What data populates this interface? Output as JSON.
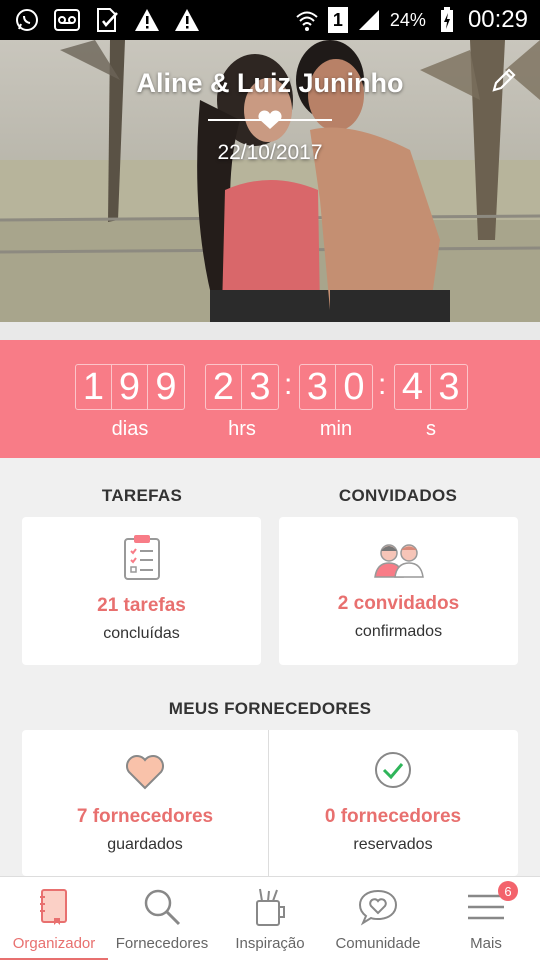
{
  "status_bar": {
    "battery_percent": "24%",
    "time": "00:29",
    "sim_slot": "1"
  },
  "hero": {
    "couple_names": "Aline & Luiz Juninho",
    "wedding_date": "22/10/2017"
  },
  "countdown": {
    "days": [
      "1",
      "9",
      "9"
    ],
    "hours": [
      "2",
      "3"
    ],
    "minutes": [
      "3",
      "0"
    ],
    "seconds": [
      "4",
      "3"
    ],
    "days_label": "dias",
    "hours_label": "hrs",
    "minutes_label": "min",
    "seconds_label": "s",
    "separator": ":"
  },
  "tasks": {
    "title": "TAREFAS",
    "value": "21 tarefas",
    "subtitle": "concluídas"
  },
  "guests": {
    "title": "CONVIDADOS",
    "value": "2 convidados",
    "subtitle": "confirmados"
  },
  "vendors": {
    "title": "MEUS FORNECEDORES",
    "saved_value": "7 fornecedores",
    "saved_subtitle": "guardados",
    "booked_value": "0 fornecedores",
    "booked_subtitle": "reservados"
  },
  "bottom_nav": {
    "items": [
      {
        "label": "Organizador",
        "icon": "notebook-icon",
        "active": true
      },
      {
        "label": "Fornecedores",
        "icon": "search-icon",
        "active": false
      },
      {
        "label": "Inspiração",
        "icon": "cup-icon",
        "active": false
      },
      {
        "label": "Comunidade",
        "icon": "chat-heart-icon",
        "active": false
      },
      {
        "label": "Mais",
        "icon": "menu-icon",
        "active": false
      }
    ],
    "more_badge": "6"
  },
  "colors": {
    "accent": "#f87c87",
    "accent_text": "#e8706f"
  }
}
